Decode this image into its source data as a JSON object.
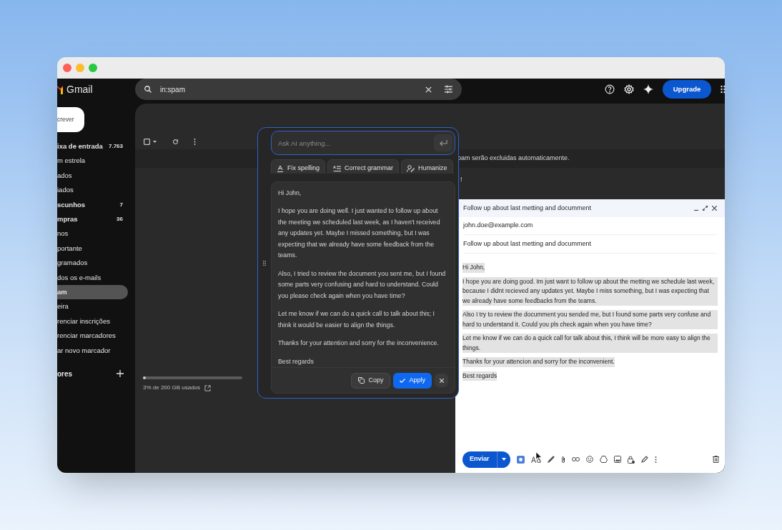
{
  "app": {
    "logo_text": "Gmail"
  },
  "search": {
    "value": "in:spam"
  },
  "upgrade_button": "Upgrade",
  "compose_button": "crever",
  "sidebar": {
    "items": [
      {
        "label": "ixa de entrada",
        "count": "7.763",
        "bold": true,
        "selected": false
      },
      {
        "label": "m estrela",
        "bold": false,
        "selected": false
      },
      {
        "label": "ados",
        "bold": false,
        "selected": false
      },
      {
        "label": "iados",
        "bold": false,
        "selected": false
      },
      {
        "label": "scunhos",
        "count": "7",
        "bold": true,
        "selected": false
      },
      {
        "label": "mpras",
        "count": "36",
        "bold": true,
        "selected": false
      },
      {
        "label": "nos",
        "bold": false,
        "selected": false
      },
      {
        "label": "portante",
        "bold": false,
        "selected": false
      },
      {
        "label": "gramados",
        "bold": false,
        "selected": false
      },
      {
        "label": "dos os e-mails",
        "bold": false,
        "selected": false
      },
      {
        "label": "am",
        "bold": true,
        "selected": true
      },
      {
        "label": "eira",
        "bold": false,
        "selected": false
      },
      {
        "label": "renciar inscrições",
        "bold": false,
        "selected": false
      },
      {
        "label": "renciar marcadores",
        "bold": false,
        "selected": false
      },
      {
        "label": "ar novo marcador",
        "bold": false,
        "selected": false
      }
    ],
    "labels_heading": "ores"
  },
  "banner": {
    "text": "pam serão excluidas automaticamente.",
    "note": "!"
  },
  "storage": {
    "text": "3% de 200 GB usados",
    "level": 0.03
  },
  "ai_panel": {
    "placeholder": "Ask AI anything...",
    "actions": [
      "Fix spelling",
      "Correct grammar",
      "Humanize"
    ],
    "result": [
      "Hi John,",
      "I hope you are doing well. I just wanted to follow up about the meeting we scheduled last week, as I haven't received any updates yet. Maybe I missed something, but I was expecting that we already have some feedback from the teams.",
      "Also, I tried to review the document you sent me, but I found some parts very confusing and hard to understand. Could you please check again when you have time?",
      "Let me know if we can do a quick call to talk about this; I think it would be easier to align the things.",
      "Thanks for your attention and sorry for the inconvenience.",
      "Best regards"
    ],
    "copy_button": "Copy",
    "apply_button": "Apply"
  },
  "compose": {
    "title": "Follow up about last metting and documment",
    "to": "john.doe@example.com",
    "subject": "Follow up about last metting and documment",
    "body_selected": true,
    "body": [
      "Hi John,",
      "I hope you are doing good. Im just want to follow up about the metting we schedule last week, because I didnt recieved any updates yet. Maybe I miss something, but I was expecting that we already have some feedbacks from the teams.",
      "Also I try to review the documment you sended me, but I found some parts very confuse and hard to understand it. Could you pls check again when you have time?",
      "Let me know if we can do a quick call for talk about this, I think will be more easy to align the things.",
      "Thanks for your attencion and sorry for the inconvenient.",
      "Best regards"
    ],
    "send_button": "Enviar"
  }
}
